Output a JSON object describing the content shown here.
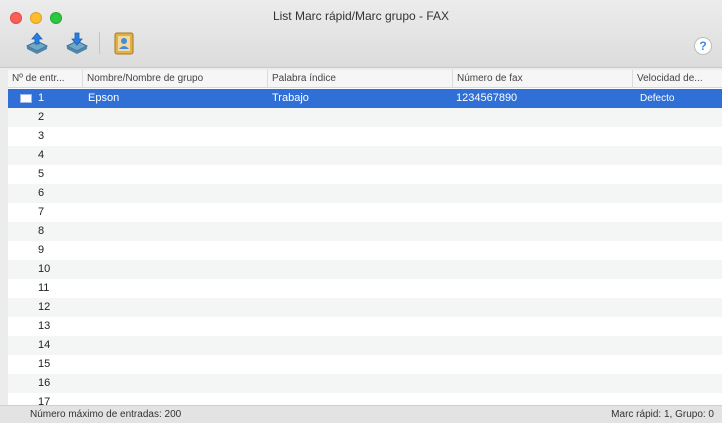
{
  "window": {
    "title": "List Marc rápid/Marc grupo - FAX"
  },
  "toolbar": {
    "buttons": [
      {
        "icon": "upload-fax-icon"
      },
      {
        "icon": "download-fax-icon"
      },
      {
        "icon": "group-contacts-icon"
      }
    ],
    "help_label": "?"
  },
  "table": {
    "columns": [
      "Nº de entr...",
      "Nombre/Nombre de grupo",
      "Palabra índice",
      "Número de fax",
      "Velocidad de..."
    ],
    "rows": [
      {
        "num": "1",
        "name": "Epson",
        "index": "Trabajo",
        "fax": "1234567890",
        "speed": "Defecto",
        "selected": true
      },
      {
        "num": "2"
      },
      {
        "num": "3"
      },
      {
        "num": "4"
      },
      {
        "num": "5"
      },
      {
        "num": "6"
      },
      {
        "num": "7"
      },
      {
        "num": "8"
      },
      {
        "num": "9"
      },
      {
        "num": "10"
      },
      {
        "num": "11"
      },
      {
        "num": "12"
      },
      {
        "num": "13"
      },
      {
        "num": "14"
      },
      {
        "num": "15"
      },
      {
        "num": "16"
      },
      {
        "num": "17"
      }
    ]
  },
  "status": {
    "left": "Número máximo de entradas: 200",
    "right": "Marc rápid: 1, Grupo: 0"
  },
  "colors": {
    "selection": "#2f6fd6",
    "accent": "#3c8ae8"
  }
}
